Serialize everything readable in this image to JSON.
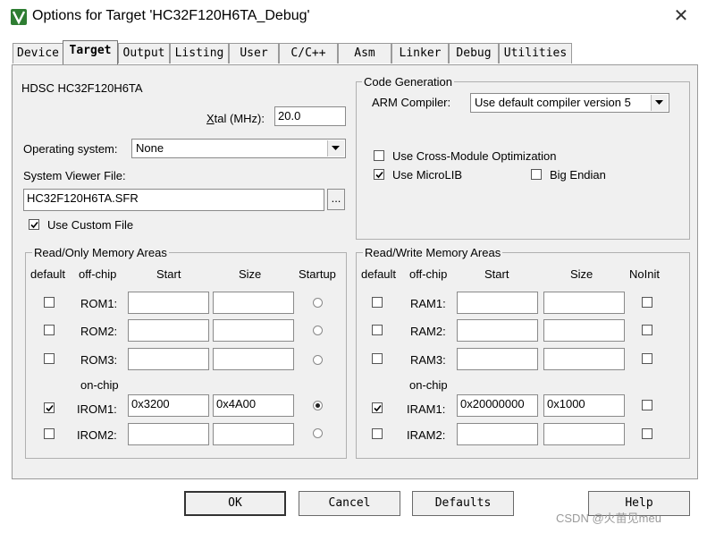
{
  "window": {
    "title": "Options for Target 'HC32F120H6TA_Debug'",
    "close_glyph": "✕"
  },
  "tabs": [
    {
      "label": "Device"
    },
    {
      "label": "Target"
    },
    {
      "label": "Output"
    },
    {
      "label": "Listing"
    },
    {
      "label": "User"
    },
    {
      "label": "C/C++"
    },
    {
      "label": "Asm"
    },
    {
      "label": "Linker"
    },
    {
      "label": "Debug"
    },
    {
      "label": "Utilities"
    }
  ],
  "target": {
    "device_name": "HDSC HC32F120H6TA",
    "xtal_label_u": "X",
    "xtal_label_rest": "tal (MHz):",
    "xtal_value": "20.0",
    "os_label": "Operating system:",
    "os_value": "None",
    "svf_label": "System Viewer File:",
    "svf_value": "HC32F120H6TA.SFR",
    "browse_label": "...",
    "custom_file_label": "Use Custom File"
  },
  "codegen": {
    "group_title": "Code Generation",
    "compiler_label": "ARM Compiler:",
    "compiler_value": "Use default compiler version 5",
    "cross_module_label": "Use Cross-Module Optimization",
    "microlib_label": "Use MicroLIB",
    "big_endian_label": "Big Endian"
  },
  "rom": {
    "group_title": "Read/Only Memory Areas",
    "headers": {
      "default": "default",
      "offchip": "off-chip",
      "start": "Start",
      "size": "Size",
      "startup": "Startup"
    },
    "onchip_label": "on-chip",
    "rows": [
      {
        "name": "ROM1:",
        "start": "",
        "size": ""
      },
      {
        "name": "ROM2:",
        "start": "",
        "size": ""
      },
      {
        "name": "ROM3:",
        "start": "",
        "size": ""
      },
      {
        "name": "IROM1:",
        "start": "0x3200",
        "size": "0x4A00"
      },
      {
        "name": "IROM2:",
        "start": "",
        "size": ""
      }
    ]
  },
  "ram": {
    "group_title": "Read/Write Memory Areas",
    "headers": {
      "default": "default",
      "offchip": "off-chip",
      "start": "Start",
      "size": "Size",
      "noinit": "NoInit"
    },
    "onchip_label": "on-chip",
    "rows": [
      {
        "name": "RAM1:",
        "start": "",
        "size": ""
      },
      {
        "name": "RAM2:",
        "start": "",
        "size": ""
      },
      {
        "name": "RAM3:",
        "start": "",
        "size": ""
      },
      {
        "name": "IRAM1:",
        "start": "0x20000000",
        "size": "0x1000"
      },
      {
        "name": "IRAM2:",
        "start": "",
        "size": ""
      }
    ]
  },
  "buttons": {
    "ok": "OK",
    "cancel": "Cancel",
    "defaults": "Defaults",
    "help": "Help"
  },
  "watermark": "CSDN @火苗见meu",
  "icons": {
    "app": "keil-uvision-icon",
    "close": "close-icon",
    "check": "check-icon",
    "dropdown": "chevron-down-icon"
  }
}
